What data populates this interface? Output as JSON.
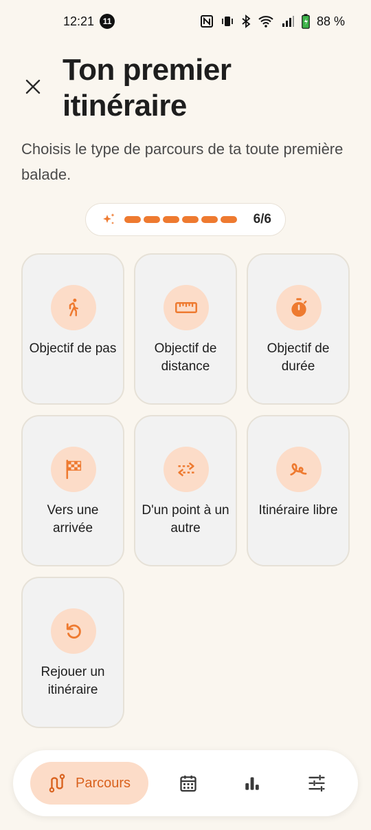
{
  "status_bar": {
    "time": "12:21",
    "notification_count": "11",
    "battery": "88 %"
  },
  "header": {
    "title": "Ton premier itinéraire",
    "subtitle": "Choisis le type de parcours de ta toute première balade."
  },
  "progress": {
    "text": "6/6",
    "completed_steps": 6,
    "total_steps": 6
  },
  "route_types": [
    {
      "label": "Objectif de pas",
      "icon": "walking-icon"
    },
    {
      "label": "Objectif de distance",
      "icon": "ruler-icon"
    },
    {
      "label": "Objectif de durée",
      "icon": "stopwatch-icon"
    },
    {
      "label": "Vers une arrivée",
      "icon": "checkered-flag-icon"
    },
    {
      "label": "D'un point à un autre",
      "icon": "swap-arrows-icon"
    },
    {
      "label": "Itinéraire libre",
      "icon": "squiggle-icon"
    },
    {
      "label": "Rejouer un itinéraire",
      "icon": "replay-icon"
    }
  ],
  "bottom_nav": {
    "active_label": "Parcours",
    "items": [
      "route-icon",
      "calendar-icon",
      "stats-icon",
      "settings-sliders-icon"
    ]
  },
  "colors": {
    "background": "#FAF6EF",
    "accent": "#EE7A30",
    "accent_soft": "#FCDCC8",
    "card": "#F2F2F2"
  }
}
